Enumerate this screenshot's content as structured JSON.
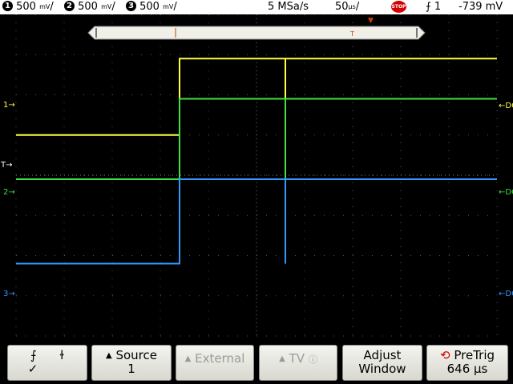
{
  "status": {
    "ch1": {
      "num": "1",
      "scale": "500",
      "unit": "mV",
      "color": "#ffff40"
    },
    "ch2": {
      "num": "2",
      "scale": "500",
      "unit": "mV",
      "color": "#40e040"
    },
    "ch3": {
      "num": "3",
      "scale": "500",
      "unit": "mV",
      "color": "#3399ff"
    },
    "sample_rate": "5 MSa/s",
    "timebase": "50",
    "timebase_unit": "µs",
    "run_state": "STOP",
    "trigger_source": "1",
    "trigger_level": "-739 mV"
  },
  "markers": {
    "ch1": "1",
    "ch2": "2",
    "ch3": "3",
    "trig_level": "T",
    "coupling": "DC"
  },
  "softkeys": {
    "slope": {
      "rising": "⨍",
      "falling": "ɫ",
      "check": "✓"
    },
    "source": {
      "label": "Source",
      "value": "1"
    },
    "external": {
      "label": "External"
    },
    "tv": {
      "label": "TV"
    },
    "adjust": {
      "label": "Adjust",
      "value": "Window"
    },
    "pretrig": {
      "label": "PreTrig",
      "value": "646 µs"
    }
  },
  "waveforms": {
    "ch1": {
      "color": "#ffff40",
      "low_level": 1,
      "high_level": 2.9
    },
    "ch2": {
      "color": "#40e040",
      "low_level": -0.1,
      "high_level": 1.9
    },
    "ch3": {
      "color": "#3399ff",
      "low_level": -2.2,
      "high_level": -0.1
    },
    "edge_time_div": -1.6,
    "glitch_time_div": 0.6
  }
}
